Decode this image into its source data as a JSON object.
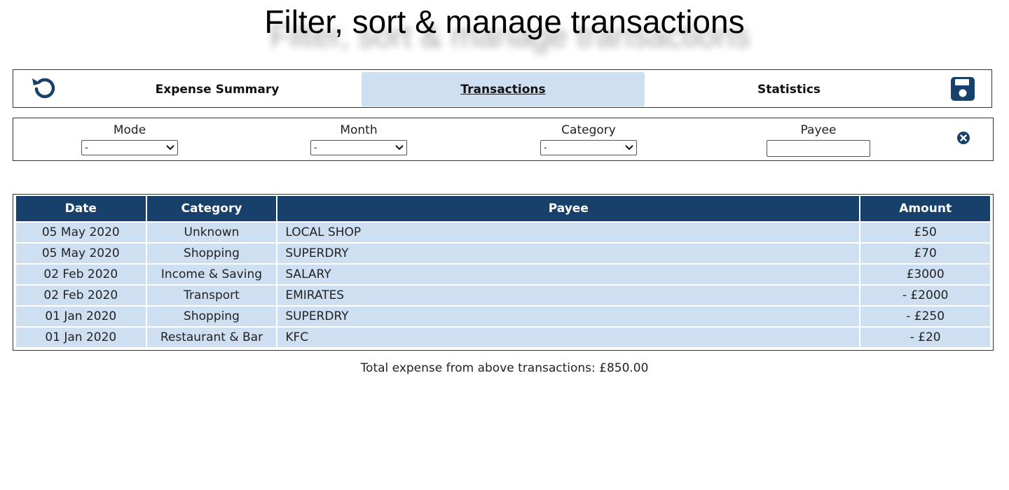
{
  "page": {
    "title": "Filter, sort & manage transactions"
  },
  "nav": {
    "tabs": [
      {
        "label": "Expense Summary",
        "active": false
      },
      {
        "label": "Transactions",
        "active": true
      },
      {
        "label": "Statistics",
        "active": false
      }
    ],
    "left_icon": "undo-icon",
    "right_icon": "save-icon",
    "accent": "#17406b",
    "active_bg": "#cfdff2"
  },
  "filters": {
    "mode": {
      "label": "Mode",
      "value": "-"
    },
    "month": {
      "label": "Month",
      "value": "-"
    },
    "category": {
      "label": "Category",
      "value": "-"
    },
    "payee": {
      "label": "Payee",
      "value": ""
    },
    "clear_icon": "clear-filter-icon"
  },
  "table": {
    "headers": [
      "Date",
      "Category",
      "Payee",
      "Amount"
    ],
    "rows": [
      {
        "date": "05 May 2020",
        "category": "Unknown",
        "payee": "LOCAL SHOP",
        "amount": "£50"
      },
      {
        "date": "05 May 2020",
        "category": "Shopping",
        "payee": "SUPERDRY",
        "amount": "£70"
      },
      {
        "date": "02 Feb 2020",
        "category": "Income & Saving",
        "payee": "SALARY",
        "amount": "£3000"
      },
      {
        "date": "02 Feb 2020",
        "category": "Transport",
        "payee": "EMIRATES",
        "amount": "- £2000"
      },
      {
        "date": "01 Jan 2020",
        "category": "Shopping",
        "payee": "SUPERDRY",
        "amount": "- £250"
      },
      {
        "date": "01 Jan 2020",
        "category": "Restaurant & Bar",
        "payee": "KFC",
        "amount": "- £20"
      }
    ]
  },
  "summary": {
    "total_text": "Total expense from above transactions: £850.00"
  }
}
